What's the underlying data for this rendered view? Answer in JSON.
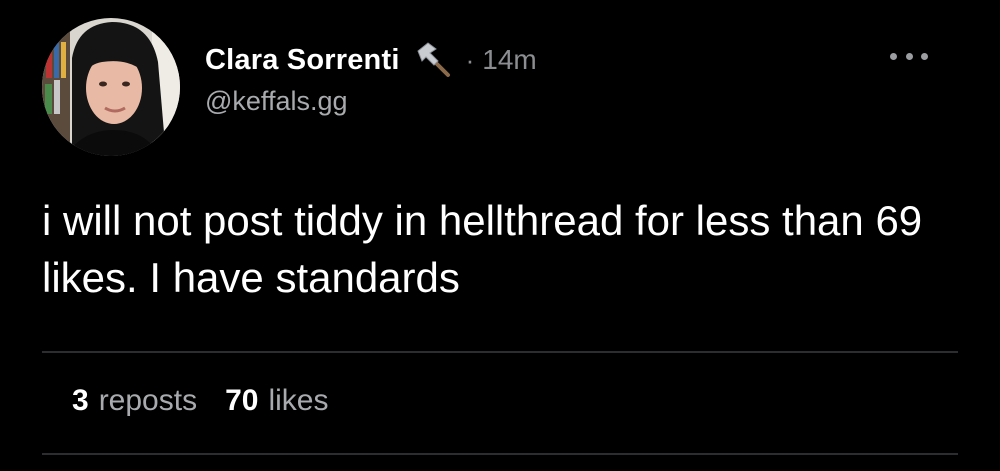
{
  "post": {
    "author": {
      "display_name": "Clara Sorrenti",
      "badge_icon": "hammer-icon",
      "handle": "@keffals.gg"
    },
    "separator": "·",
    "time_ago": "14m",
    "more_icon": "more-horizontal-icon",
    "text": "i will not post tiddy in hellthread for less than 69 likes. I have standards",
    "stats": {
      "reposts_count": "3",
      "reposts_label": "reposts",
      "likes_count": "70",
      "likes_label": "likes"
    }
  },
  "colors": {
    "background": "#000000",
    "primary_text": "#ffffff",
    "secondary_text": "#8b8d91",
    "divider": "#2b2d31"
  }
}
